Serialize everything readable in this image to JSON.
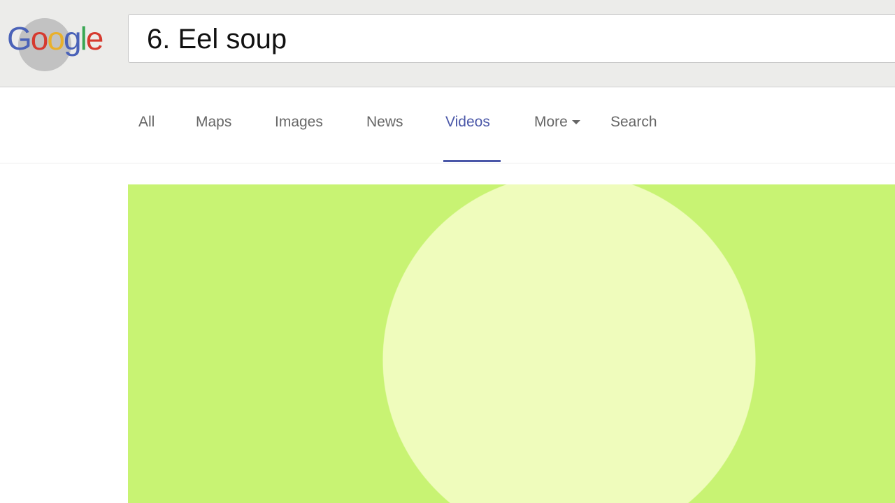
{
  "logo": {
    "text": "Google",
    "letters": [
      "G",
      "o",
      "o",
      "g",
      "l",
      "e"
    ],
    "colors": [
      "#4a62b8",
      "#d63a2f",
      "#e9b02a",
      "#4a62b8",
      "#3aa654",
      "#d63a2f"
    ]
  },
  "search": {
    "value": "6. Eel soup"
  },
  "tabs": [
    {
      "label": "All"
    },
    {
      "label": "Maps"
    },
    {
      "label": "Images"
    },
    {
      "label": "News"
    },
    {
      "label": "Videos",
      "active": true
    },
    {
      "label": "More",
      "icon": "caret-down-icon"
    },
    {
      "label": "Search"
    }
  ],
  "colors": {
    "accent": "#4a57a8",
    "panel": "#c8f373",
    "circle": "#effcbc"
  }
}
